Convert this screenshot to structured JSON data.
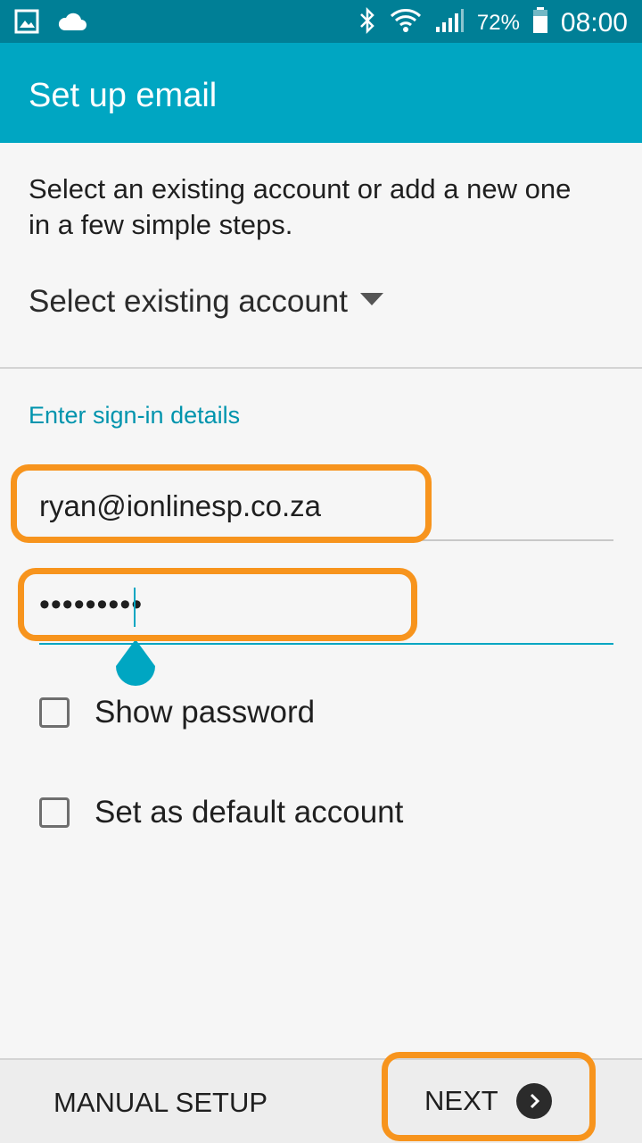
{
  "status_bar": {
    "battery_percent": "72%",
    "time": "08:00",
    "icons": [
      "image-icon",
      "cloud-icon",
      "bluetooth-icon",
      "wifi-icon",
      "signal-icon",
      "battery-icon"
    ]
  },
  "app_bar": {
    "title": "Set up email"
  },
  "intro": {
    "text": "Select an existing account or add a new one in a few simple steps."
  },
  "account_select": {
    "label": "Select existing account",
    "icon": "dropdown-arrow-icon"
  },
  "sign_in": {
    "section_label": "Enter sign-in details",
    "email_value": "ryan@ionlinesp.co.za",
    "password_value": "•••••••••"
  },
  "options": {
    "show_password": {
      "label": "Show password",
      "checked": false
    },
    "default_account": {
      "label": "Set as default account",
      "checked": false
    }
  },
  "bottom_bar": {
    "manual_setup_label": "MANUAL SETUP",
    "next_label": "NEXT",
    "next_icon": "chevron-right-icon"
  },
  "colors": {
    "accent": "#00a6c2",
    "status_bar": "#007f96",
    "highlight": "#f7941d"
  }
}
